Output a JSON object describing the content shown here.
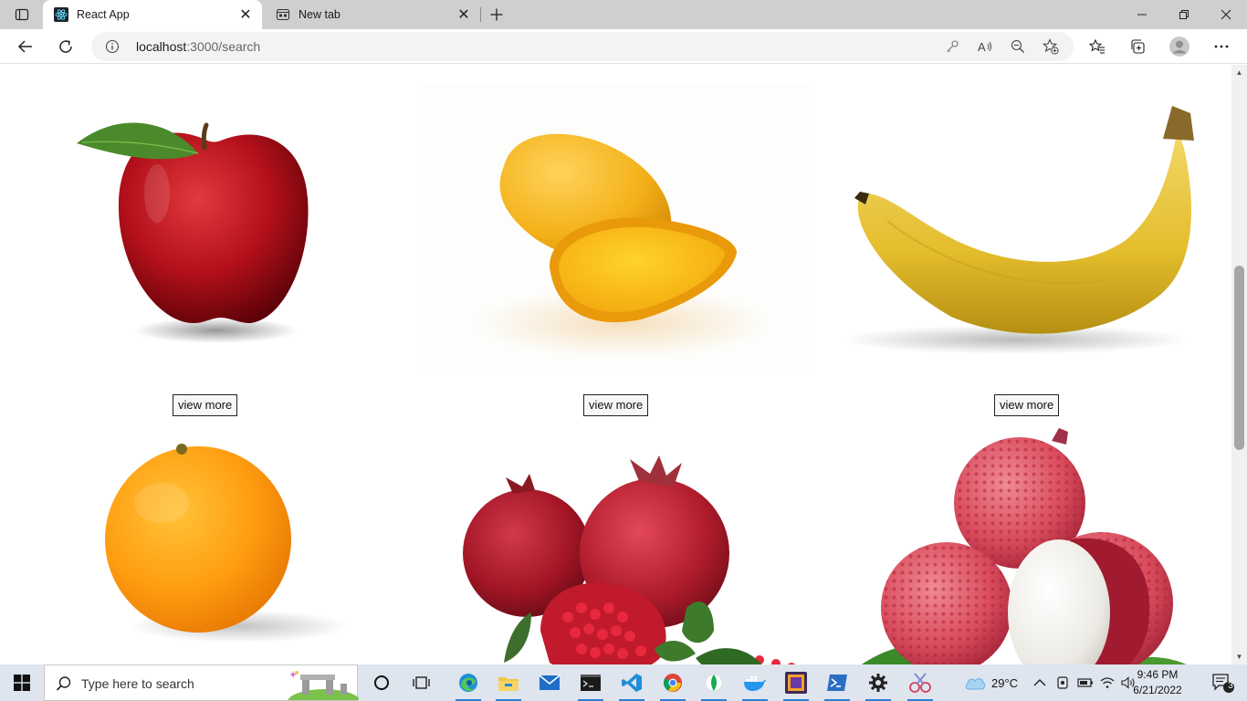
{
  "browser": {
    "tabs": [
      {
        "title": "React App",
        "active": true
      },
      {
        "title": "New tab",
        "active": false
      }
    ],
    "address": {
      "host": "localhost",
      "rest": ":3000/search"
    }
  },
  "page": {
    "cards": [
      {
        "fruit": "apple",
        "button_label": "view more"
      },
      {
        "fruit": "mango",
        "button_label": "view more"
      },
      {
        "fruit": "banana",
        "button_label": "view more"
      },
      {
        "fruit": "orange",
        "button_label": ""
      },
      {
        "fruit": "pomegranate",
        "button_label": ""
      },
      {
        "fruit": "lychee",
        "button_label": ""
      }
    ]
  },
  "taskbar": {
    "search_placeholder": "Type here to search",
    "apps": [
      "task-view",
      "edge",
      "file-explorer",
      "mail",
      "terminal",
      "vs-code",
      "chrome",
      "mongodb-compass",
      "docker",
      "beekeeper",
      "powershell",
      "settings",
      "snipping-tool"
    ],
    "weather": "29°C",
    "time": "9:46 PM",
    "date": "6/21/2022",
    "notification_count": "3"
  },
  "colors": {
    "tabstrip": "#cfcfcf",
    "taskbar": "#dfe5ee",
    "accent": "#2b7fd4"
  }
}
